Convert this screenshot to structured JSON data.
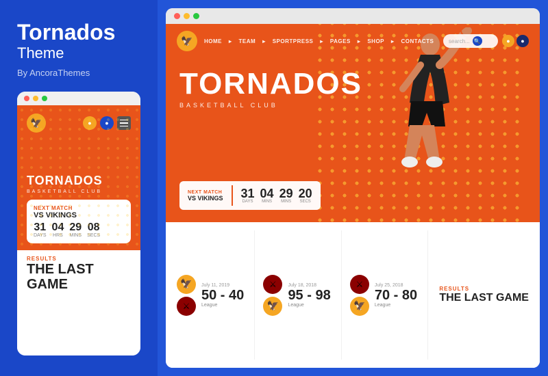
{
  "left": {
    "brand": {
      "title": "Tornados",
      "subtitle": "Theme",
      "by": "By AncoraThemes"
    },
    "mobile": {
      "dots": [
        "red",
        "yellow",
        "green"
      ],
      "hero": {
        "title": "TORNADOS",
        "subtitle": "BASKETBALL CLUB"
      },
      "match": {
        "label": "NEXT MATCH",
        "vs": "VS VIKINGS"
      },
      "countdown": [
        {
          "num": "31",
          "label": "Days"
        },
        {
          "num": "04",
          "label": "Hrs"
        },
        {
          "num": "29",
          "label": "Mins"
        },
        {
          "num": "08",
          "label": "Secs"
        }
      ],
      "results": {
        "label": "RESULTS",
        "title": "THE LAST GAME"
      }
    }
  },
  "right": {
    "desktop": {
      "dots": [
        "red",
        "yellow",
        "green"
      ],
      "nav": {
        "links": [
          "HOME",
          "TEAM",
          "SPORTPRESS",
          "PAGES",
          "SHOP",
          "CONTACTS"
        ],
        "search_placeholder": "search..."
      },
      "hero": {
        "title": "TORNADOS",
        "subtitle": "BASKETBALL CLUB"
      },
      "match": {
        "label": "NEXT MATCH",
        "vs": "VS VIKINGS"
      },
      "countdown": [
        {
          "num": "31",
          "label": "Days"
        },
        {
          "num": "04",
          "label": "Mins"
        },
        {
          "num": "29",
          "label": "Mins"
        },
        {
          "num": "20",
          "label": "Secs"
        }
      ],
      "results": [
        {
          "date": "July 11, 2019",
          "score": "50 - 40",
          "league": "League"
        },
        {
          "date": "July 18, 2018",
          "score": "95 - 98",
          "league": "League"
        },
        {
          "date": "July 25, 2018",
          "score": "70 - 80",
          "league": "League"
        }
      ],
      "last_game": {
        "label": "RESULTS",
        "title": "THE LAST GAME"
      }
    }
  }
}
